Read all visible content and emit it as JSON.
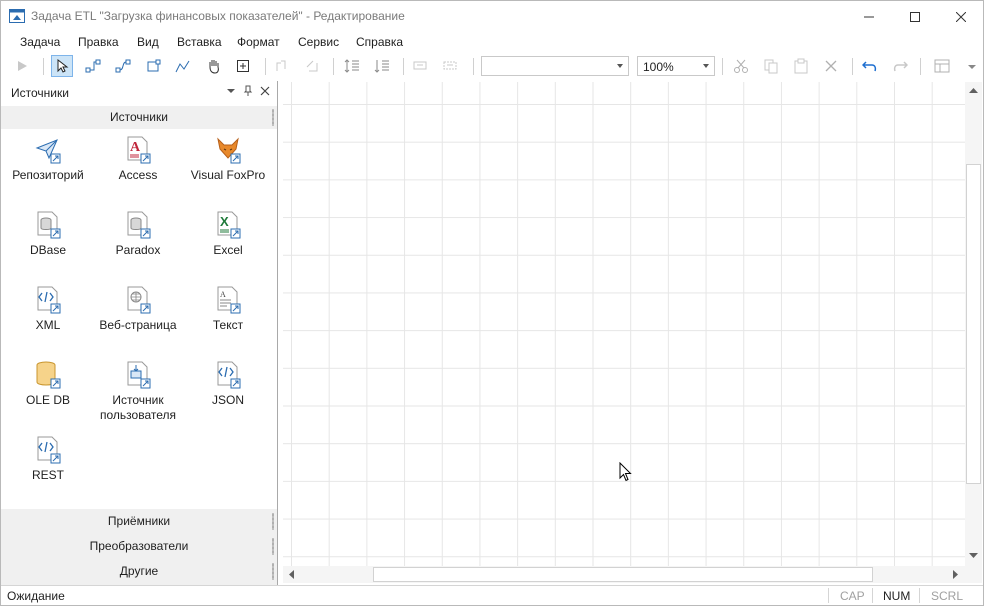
{
  "window": {
    "title": "Задача ETL \"Загрузка финансовых показателей\" - Редактирование"
  },
  "menu": [
    "Задача",
    "Правка",
    "Вид",
    "Вставка",
    "Формат",
    "Сервис",
    "Справка"
  ],
  "toolbar": {
    "font_combo": "",
    "zoom_combo": "100%"
  },
  "panel": {
    "title": "Источники",
    "active_section": "Источники",
    "items": [
      {
        "label": "Репозиторий",
        "icon": "repository-icon"
      },
      {
        "label": "Access",
        "icon": "access-icon"
      },
      {
        "label": "Visual FoxPro",
        "icon": "foxpro-icon"
      },
      {
        "label": "DBase",
        "icon": "dbase-icon"
      },
      {
        "label": "Paradox",
        "icon": "paradox-icon"
      },
      {
        "label": "Excel",
        "icon": "excel-icon"
      },
      {
        "label": "XML",
        "icon": "xml-icon"
      },
      {
        "label": "Веб-страница",
        "icon": "web-page-icon"
      },
      {
        "label": "Текст",
        "icon": "text-icon"
      },
      {
        "label": "OLE DB",
        "icon": "ole-db-icon"
      },
      {
        "label": "Источник\nпользователя",
        "icon": "user-source-icon"
      },
      {
        "label": "JSON",
        "icon": "json-icon"
      },
      {
        "label": "REST",
        "icon": "rest-icon"
      }
    ],
    "sections": [
      "Приёмники",
      "Преобразователи",
      "Другие"
    ]
  },
  "status": {
    "text": "Ожидание",
    "indicators": [
      {
        "label": "CAP",
        "active": false
      },
      {
        "label": "NUM",
        "active": true
      },
      {
        "label": "SCRL",
        "active": false
      }
    ]
  },
  "colors": {
    "accent": "#1e6fd0",
    "active_tool_bg": "#cce4f7",
    "grid": "#e6e6e6"
  }
}
